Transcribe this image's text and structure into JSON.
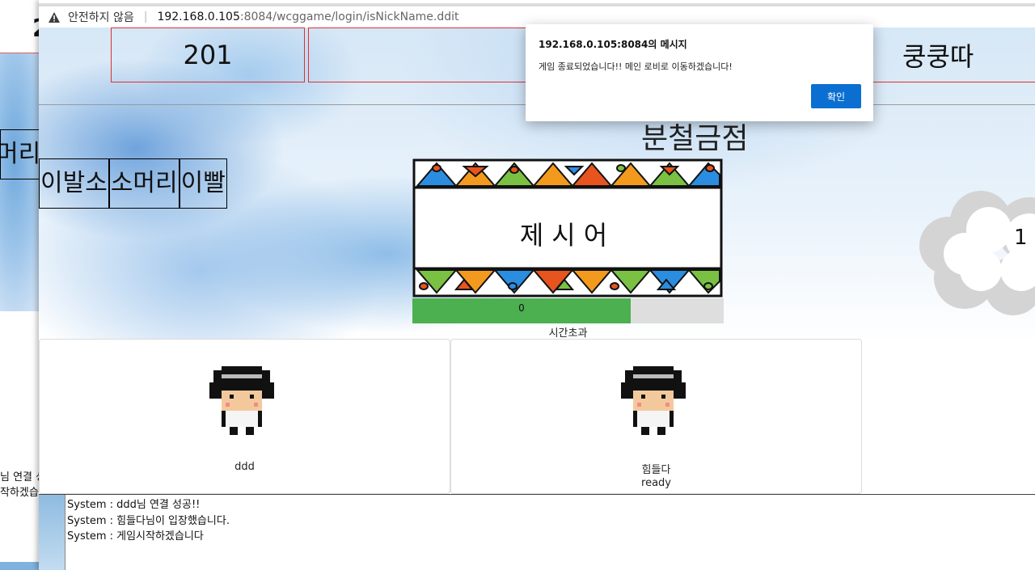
{
  "background_window": {
    "top_number": "2",
    "word_fragment": "머리이",
    "chat_line_1": "님 연결 성",
    "chat_line_2": "작하겠습"
  },
  "browser": {
    "security_label": "안전하지 않음",
    "url_host": "192.168.0.105",
    "url_rest": ":8084/wcggame/login/isNickName.ddit"
  },
  "header": {
    "room_number": "201",
    "middle_text": "",
    "nickname": "쿵쿵따"
  },
  "game": {
    "answer_word": "분철금점",
    "previous_words": [
      "이발소",
      "소머리",
      "이빨"
    ],
    "suggestion_label": "제시어",
    "timer_value": "0",
    "timer_progress_percent": 70,
    "timeout_label": "시간초과",
    "cloud_number": "1"
  },
  "players": [
    {
      "name": "ddd",
      "status": ""
    },
    {
      "name": "힘들다",
      "status": "ready"
    }
  ],
  "chat": {
    "messages": [
      "System : ddd님 연결 성공!!",
      "System : 힘들다님이 입장했습니다.",
      "System : 게임시작하겠습니다"
    ]
  },
  "dialog": {
    "title": "192.168.0.105:8084의 메시지",
    "message": "게임 종료되었습니다!! 메인 로비로 이동하겠습니다!",
    "ok_label": "확인"
  },
  "colors": {
    "timer_fill": "#4caf50",
    "header_border": "#e03030",
    "dialog_button": "#0b6fd1"
  }
}
